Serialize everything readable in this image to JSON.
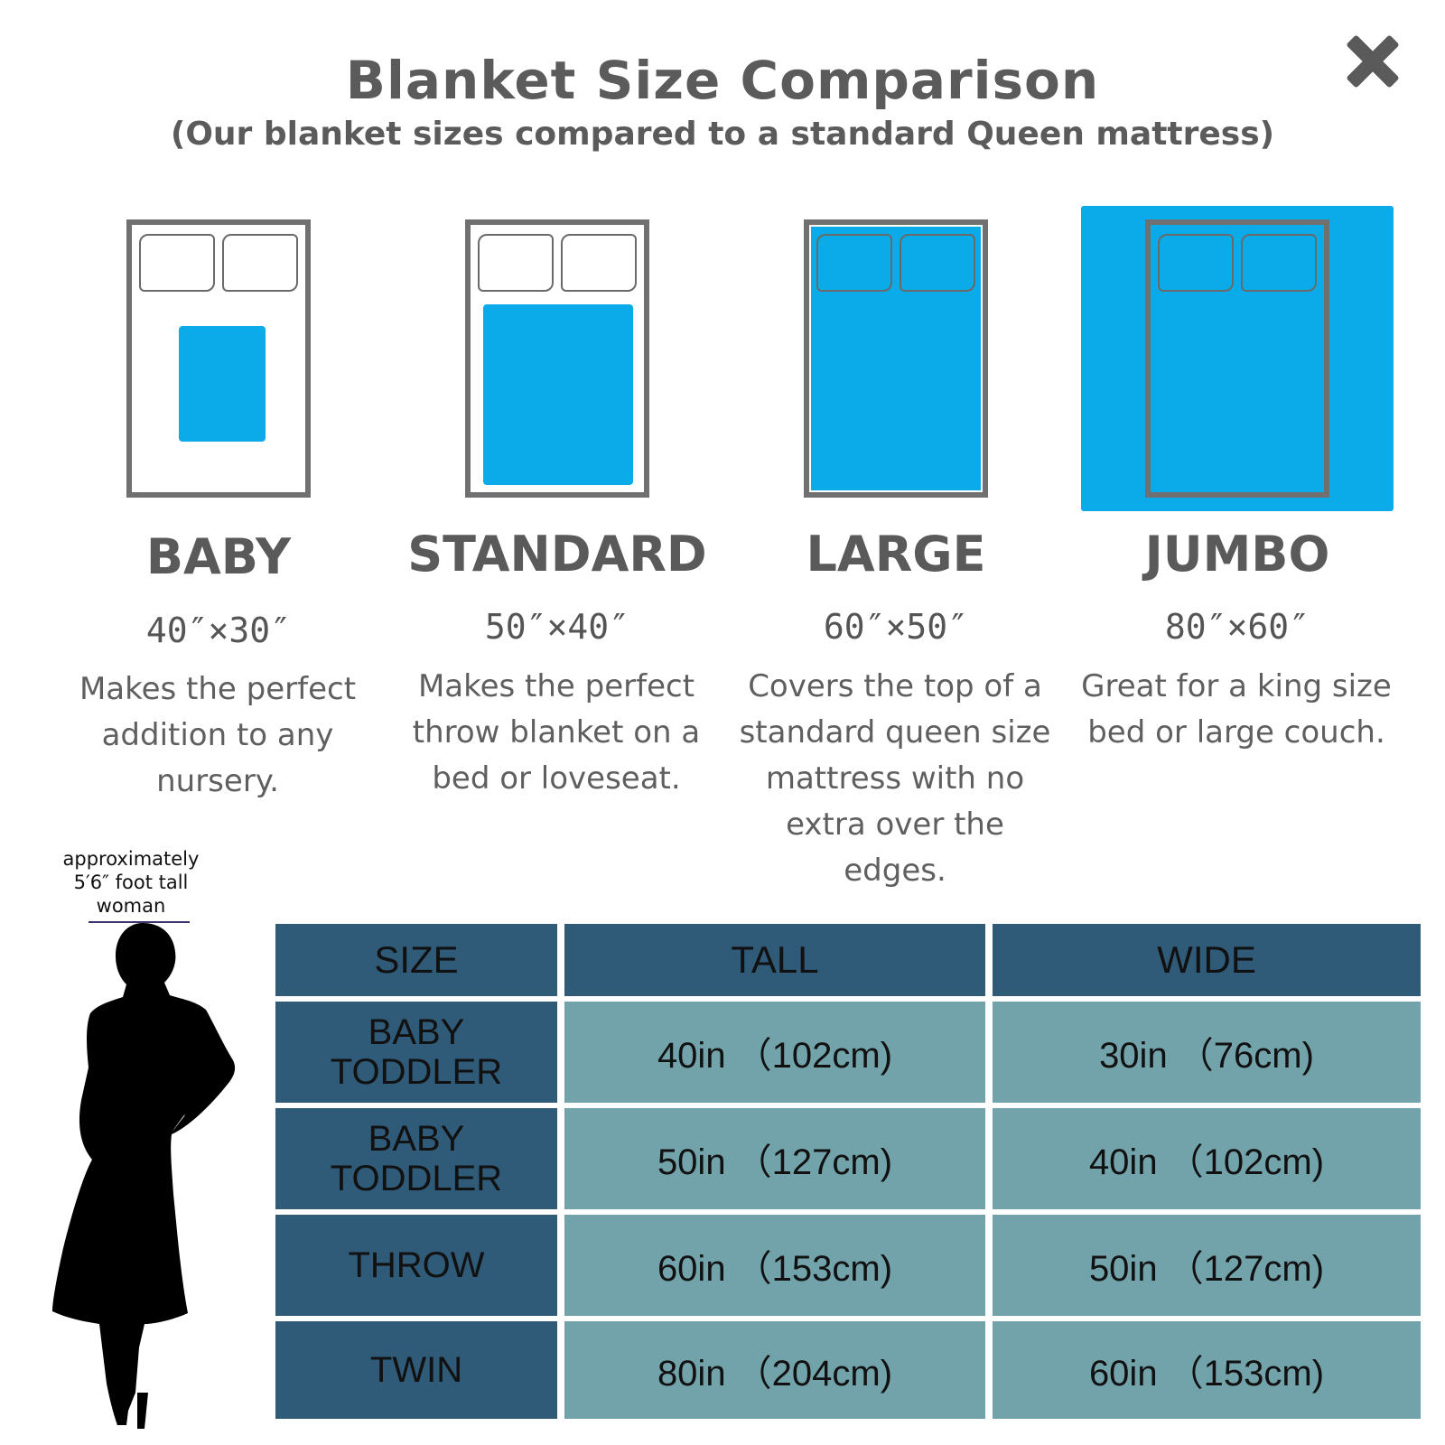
{
  "header": {
    "title": "Blanket Size Comparison",
    "subtitle": "(Our blanket sizes compared to a standard Queen mattress)"
  },
  "icons": {
    "close": "close-x-icon"
  },
  "colors": {
    "blanket": "#0aabe8",
    "table_header": "#2f5a78",
    "table_cell": "#72a2aa",
    "text": "#5a5a5a"
  },
  "sizes": [
    {
      "name": "BABY",
      "dimensions": "40″×30″",
      "description": "Makes the perfect addition to any nursery."
    },
    {
      "name": "STANDARD",
      "dimensions": "50″×40″",
      "description": "Makes the perfect throw blanket on a bed or loveseat."
    },
    {
      "name": "LARGE",
      "dimensions": "60″×50″",
      "description": "Covers the top of a standard queen size mattress with no extra over the edges."
    },
    {
      "name": "JUMBO",
      "dimensions": "80″×60″",
      "description": "Great for a king size bed or large couch."
    }
  ],
  "woman_note": {
    "line1": "approximately",
    "line2": "5′6″ foot tall",
    "line3": "woman"
  },
  "table": {
    "headers": [
      "SIZE",
      "TALL",
      "WIDE"
    ],
    "rows": [
      {
        "size_line1": "BABY",
        "size_line2": "TODDLER",
        "tall": "40in （102cm)",
        "wide": "30in （76cm)"
      },
      {
        "size_line1": "BABY",
        "size_line2": "TODDLER",
        "tall": "50in （127cm)",
        "wide": "40in （102cm)"
      },
      {
        "size_line1": "THROW",
        "size_line2": "",
        "tall": "60in （153cm)",
        "wide": "50in （127cm)"
      },
      {
        "size_line1": "TWIN",
        "size_line2": "",
        "tall": "80in （204cm)",
        "wide": "60in （153cm)"
      }
    ]
  }
}
